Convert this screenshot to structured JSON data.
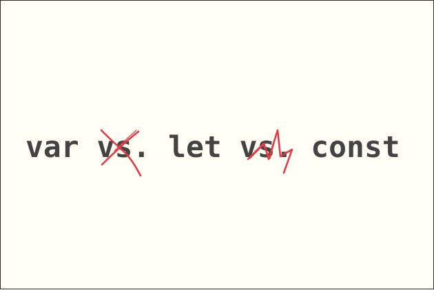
{
  "headline": {
    "text": "var vs. let vs. const"
  },
  "annotations": {
    "scribble_color": "#e23b46",
    "marks": [
      {
        "name": "first-vs",
        "style": "x-cross"
      },
      {
        "name": "second-vs",
        "style": "zigzag-scribble"
      }
    ]
  },
  "colors": {
    "background": "#fffff6",
    "border": "#2b2b2b",
    "text": "#434343"
  }
}
